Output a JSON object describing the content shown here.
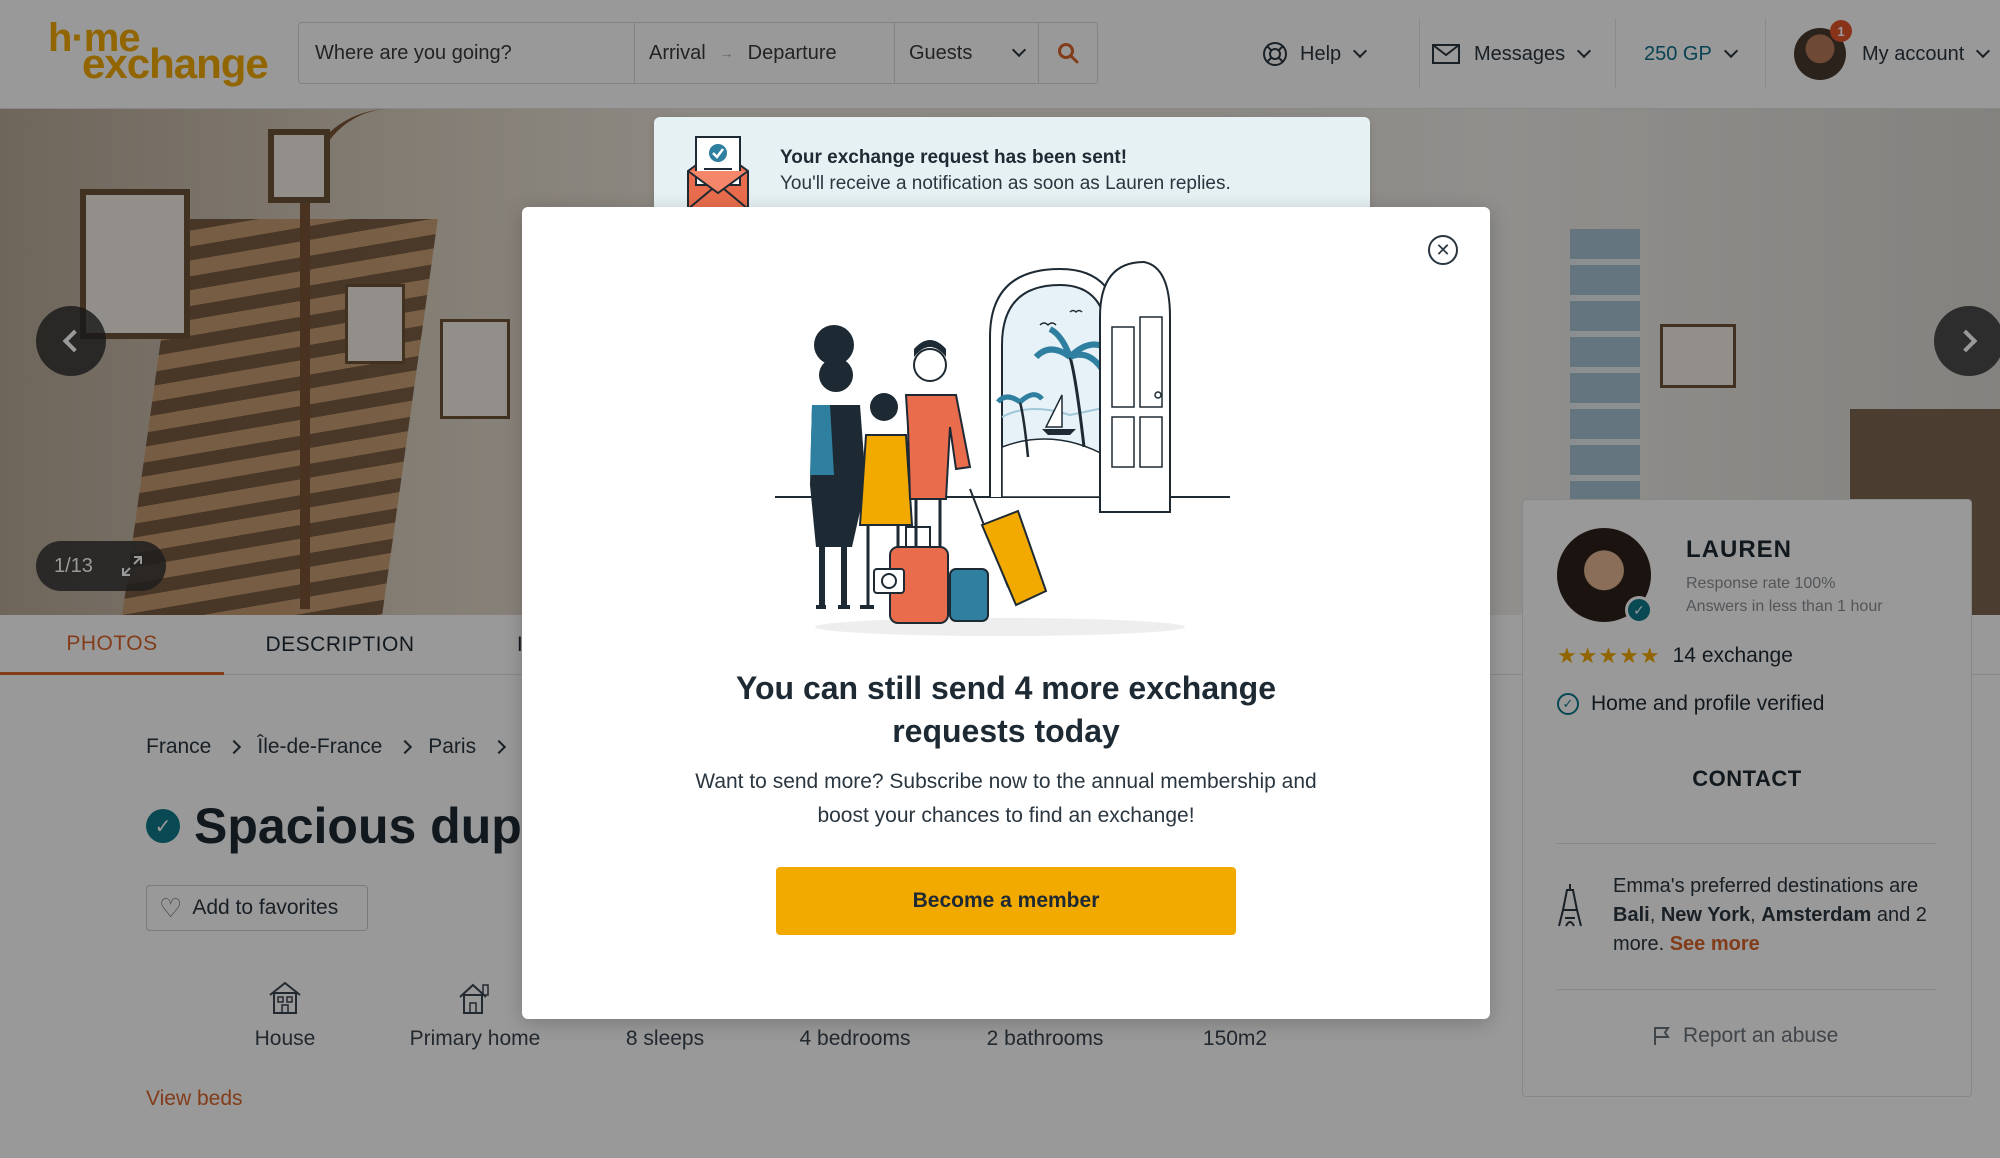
{
  "header": {
    "logo_top": "h·me",
    "logo_bottom": "exchange",
    "search": {
      "where_placeholder": "Where are you going?",
      "arrival": "Arrival",
      "departure": "Departure",
      "guests": "Guests"
    },
    "nav": {
      "help": "Help",
      "messages": "Messages",
      "points": "250 GP",
      "account": "My account",
      "notification_count": "1"
    },
    "colors": {
      "brand": "#f2a900",
      "accent": "#d9642b",
      "points": "#0e6f8a"
    }
  },
  "hero": {
    "counter": "1/13"
  },
  "tabs": [
    {
      "label": "PHOTOS"
    },
    {
      "label": "DESCRIPTION"
    },
    {
      "label": "I"
    }
  ],
  "breadcrumb": [
    "France",
    "Île-de-France",
    "Paris"
  ],
  "listing": {
    "title": "Spacious dupl",
    "add_to_favorites": "Add to favorites",
    "features": [
      {
        "label": "House",
        "icon": "house-icon"
      },
      {
        "label": "Primary home",
        "icon": "home-icon"
      },
      {
        "label": "8 sleeps"
      },
      {
        "label": "4 bedrooms"
      },
      {
        "label": "2 bathrooms"
      },
      {
        "label": "150m2"
      }
    ],
    "view_beds": "View beds"
  },
  "host": {
    "name": "LAUREN",
    "response_rate": "Response rate 100%",
    "answers": "Answers in less than 1 hour",
    "stars": "★★★★★",
    "rating": 5,
    "exchanges": "14 exchange",
    "verified": "Home and profile verified",
    "contact": "CONTACT",
    "prefs_intro": "Emma's preferred destinations are",
    "prefs_dest1": "Bali",
    "prefs_dest2": "New York",
    "prefs_dest3": "Amsterdam",
    "prefs_and": "and 2 more.",
    "see_more": "See more",
    "report": "Report an abuse"
  },
  "toast": {
    "title": "Your exchange request has been sent!",
    "body": "You'll receive a notification as soon as Lauren replies."
  },
  "modal": {
    "title_line1": "You can still send 4 more exchange",
    "title_line2": "requests today",
    "body_line1": "Want to send more? Subscribe now to the annual membership and",
    "body_line2": "boost your chances to find an exchange!",
    "cta": "Become a member"
  }
}
